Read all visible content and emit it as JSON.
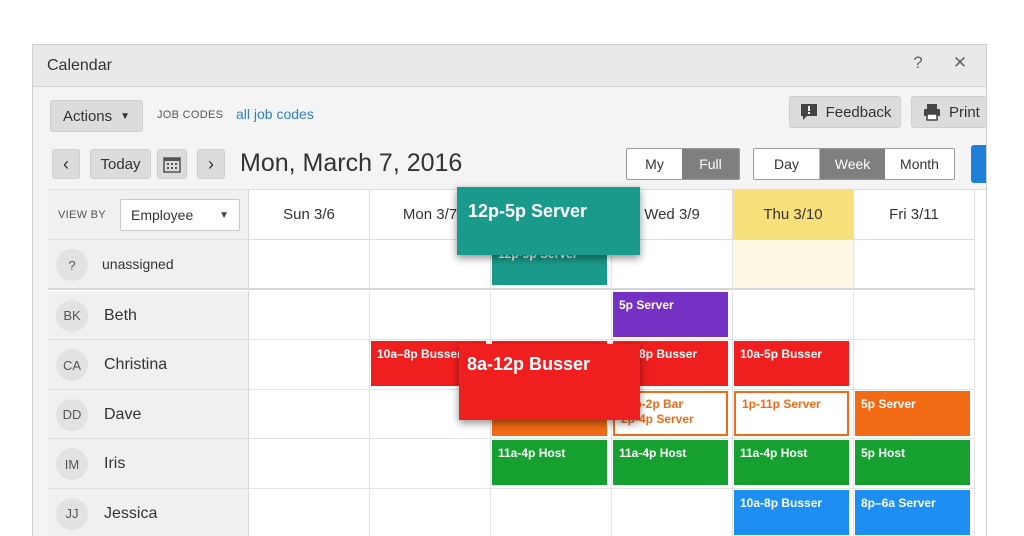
{
  "window": {
    "title": "Calendar",
    "help": "?",
    "close": "✕"
  },
  "toolbar": {
    "actions_label": "Actions",
    "job_codes_label": "JOB CODES",
    "job_codes_link": "all job codes",
    "feedback_label": "Feedback",
    "print_label": "Print"
  },
  "nav": {
    "today_label": "Today",
    "date_title": "Mon, March 7, 2016",
    "scope_options": [
      "My",
      "Full"
    ],
    "scope_selected": "Full",
    "range_options": [
      "Day",
      "Week",
      "Month"
    ],
    "range_selected": "Week"
  },
  "viewby": {
    "label": "VIEW BY",
    "selected": "Employee"
  },
  "days": [
    "Sun  3/6",
    "Mon  3/7",
    "Tue  3/8",
    "Wed  3/9",
    "Thu  3/10",
    "Fri  3/11"
  ],
  "highlight_day": "Thu  3/10",
  "employees": [
    {
      "initials": "?",
      "name": "unassigned"
    },
    {
      "initials": "BK",
      "name": "Beth"
    },
    {
      "initials": "CA",
      "name": "Christina"
    },
    {
      "initials": "DD",
      "name": "Dave"
    },
    {
      "initials": "IM",
      "name": "Iris"
    },
    {
      "initials": "JJ",
      "name": "Jessica"
    }
  ],
  "shifts": [
    {
      "row": 0,
      "day": 2,
      "label": "12p-5p Server",
      "color": "#1a9a8a",
      "style": "solid"
    },
    {
      "row": 1,
      "day": 3,
      "label": "5p Server",
      "color": "#7431c4",
      "style": "solid"
    },
    {
      "row": 2,
      "day": 1,
      "label": "10a–8p Busser",
      "color": "#ef1f1f",
      "style": "solid"
    },
    {
      "row": 2,
      "day": 2,
      "label": "8a-12p Busser",
      "color": "#ef1f1f",
      "style": "solid"
    },
    {
      "row": 2,
      "day": 3,
      "label": "8a–8p Busser",
      "color": "#ef1f1f",
      "style": "solid"
    },
    {
      "row": 2,
      "day": 4,
      "label": "10a-5p Busser",
      "color": "#ef1f1f",
      "style": "solid"
    },
    {
      "row": 3,
      "day": 2,
      "label": "",
      "color": "#f26a14",
      "style": "solid"
    },
    {
      "row": 3,
      "day": 3,
      "label": "15p-2p Bar",
      "label2": "2p-4p Server",
      "color": "#f26a14",
      "style": "outline"
    },
    {
      "row": 3,
      "day": 4,
      "label": "1p-11p Server",
      "color": "#f26a14",
      "style": "outline"
    },
    {
      "row": 3,
      "day": 5,
      "label": "5p Server",
      "color": "#f26a14",
      "style": "solid"
    },
    {
      "row": 4,
      "day": 2,
      "label": "11a-4p Host",
      "color": "#15a030",
      "style": "solid"
    },
    {
      "row": 4,
      "day": 3,
      "label": "11a-4p Host",
      "color": "#15a030",
      "style": "solid"
    },
    {
      "row": 4,
      "day": 4,
      "label": "11a-4p Host",
      "color": "#15a030",
      "style": "solid"
    },
    {
      "row": 4,
      "day": 5,
      "label": "5p Host",
      "color": "#15a030",
      "style": "solid"
    },
    {
      "row": 5,
      "day": 4,
      "label": "10a-8p Busser",
      "color": "#1e8ff2",
      "style": "solid"
    },
    {
      "row": 5,
      "day": 5,
      "label": "8p–6a Server",
      "color": "#1e8ff2",
      "style": "solid"
    }
  ],
  "drag_cards": [
    {
      "label": "12p-5p Server",
      "color": "#1a9a8a"
    },
    {
      "label": "8a-12p Busser",
      "color": "#ef1f1f"
    }
  ]
}
